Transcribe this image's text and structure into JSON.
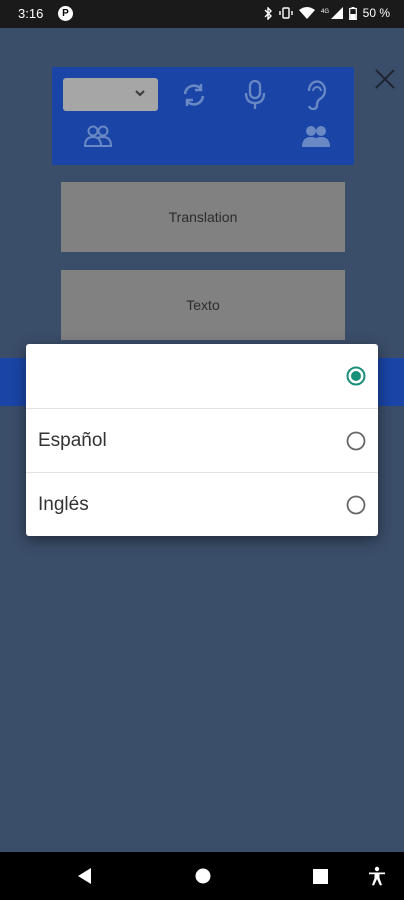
{
  "status_bar": {
    "time": "3:16",
    "app_badge": "P",
    "battery_text": "50 %"
  },
  "main": {
    "translation_button": "Translation",
    "text_button": "Texto"
  },
  "language_dialog": {
    "options": [
      {
        "label": "",
        "selected": true
      },
      {
        "label": "Español",
        "selected": false
      },
      {
        "label": "Inglés",
        "selected": false
      }
    ]
  },
  "colors": {
    "toolbar_blue": "#1a45a6",
    "overlay_bg": "#3a4d69",
    "radio_accent": "#1a8f7a"
  },
  "icons": {
    "close": "close-icon",
    "swap": "swap-icon",
    "mic": "mic-icon",
    "ear": "ear-icon",
    "group_outline": "people-outline-icon",
    "group_filled": "people-filled-icon"
  }
}
